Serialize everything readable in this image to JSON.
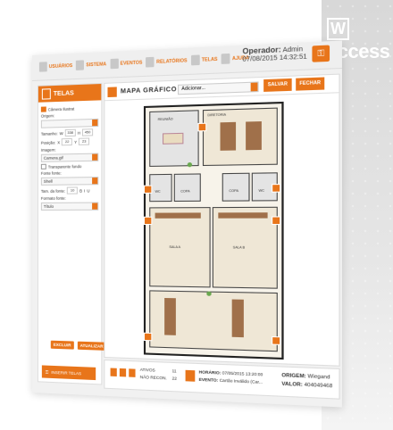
{
  "brand": {
    "name": "access",
    "mark": "W"
  },
  "menu": [
    {
      "label": "USUÁRIOS",
      "icon": "users-icon"
    },
    {
      "label": "SISTEMA",
      "icon": "system-icon"
    },
    {
      "label": "EVENTOS",
      "icon": "events-icon"
    },
    {
      "label": "RELATÓRIOS",
      "icon": "reports-icon"
    },
    {
      "label": "TELAS",
      "icon": "screens-icon"
    },
    {
      "label": "AJUDA",
      "icon": "help-icon"
    }
  ],
  "operator": {
    "label": "Operador:",
    "name": "Admin",
    "datetime": "07/08/2015 14:32:51"
  },
  "left_panel": {
    "title": "TELAS",
    "camera_label": "Câmera Ilustrat",
    "origin_label": "Origem:",
    "size_label": "Tamanho:",
    "size_w_label": "W",
    "size_w": "338",
    "size_h_label": "H",
    "size_h": "450",
    "position_label": "Posição:",
    "pos_x_label": "X",
    "pos_x": "22",
    "pos_y_label": "Y",
    "pos_y": "23",
    "image_label": "Imagem:",
    "image_value": "Camera.gif",
    "transparent_label": "Transparente fundo",
    "font_label": "Fonte fonte:",
    "font_value": "Shell",
    "font_size_label": "Tam. da fonte:",
    "font_size": "10",
    "bold_label": "B",
    "italic_label": "I",
    "underline_label": "U",
    "font_format_label": "Formato fonte:",
    "font_format_value": "Título",
    "btn_delete": "EXCLUIR",
    "btn_update": "ATUALIZAR",
    "btn_new_screen": "INSERIR TELAS"
  },
  "center": {
    "title": "MAPA GRÁFICO (1)",
    "select_value": "Adicionar...",
    "save": "SALVAR",
    "close": "FECHAR",
    "rooms": {
      "meeting": "REUNIÃO",
      "directors": "DIRETORIA",
      "wc_m": "WC",
      "wc_f": "WC",
      "copa": "COPA",
      "sala_a": "SALA A",
      "sala_b": "SALA B"
    }
  },
  "bottom": {
    "active_label": "ATIVOS",
    "active_value": "11",
    "not_recognized_label": "NÃO RECON.",
    "not_recognized_value": "22",
    "time_label": "HORÁRIO:",
    "time_value": "07/05/2015 13:20:00",
    "event_label": "EVENTO:",
    "event_value": "Cartão Inválido (Car...",
    "origin_label": "ORIGEM:",
    "origin_value": "Wiegand",
    "value_label": "VALOR:",
    "value_value": "404049468"
  },
  "colors": {
    "accent": "#e8751a",
    "panel": "#f1f1f1"
  }
}
